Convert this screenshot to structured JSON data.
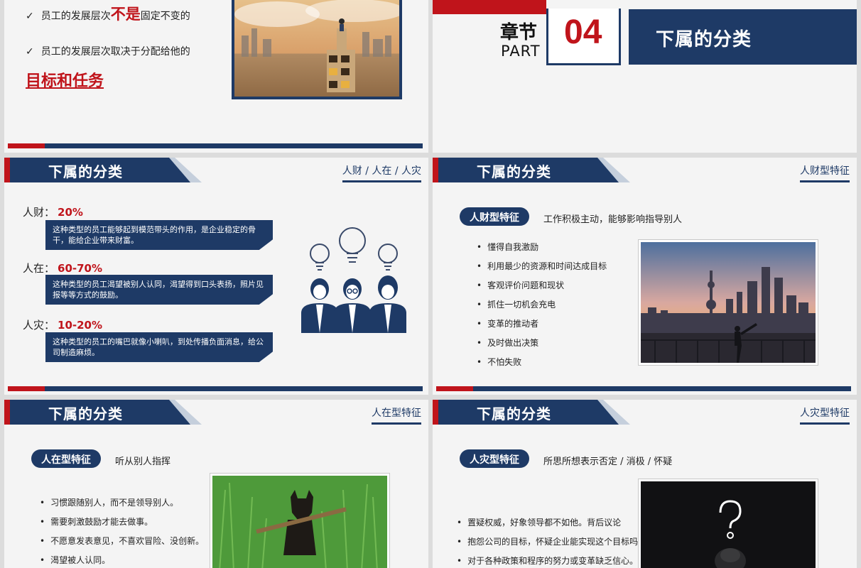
{
  "slide1": {
    "bullets": [
      {
        "mark": "✓",
        "before": "员工的发展层次",
        "highlight": "不是",
        "after": "固定不变的"
      },
      {
        "mark": "✓",
        "before": "员工的发展层次取决于分配给他的",
        "highlight": "",
        "after": ""
      }
    ],
    "emphasis": "目标和任务"
  },
  "slide2": {
    "chapter": "章节",
    "part": "PART",
    "number": "04",
    "title": "下属的分类"
  },
  "slide3": {
    "header": "下属的分类",
    "tag": "人财 / 人在 / 人灾",
    "items": [
      {
        "label": "人财：",
        "pct": "20%",
        "desc": "这种类型的员工能够起到模范带头的作用，是企业稳定的骨干，能给企业带来财富。"
      },
      {
        "label": "人在：",
        "pct": "60-70%",
        "desc": "这种类型的员工渴望被别人认同，渴望得到口头表扬，照片见报等等方式的鼓励。"
      },
      {
        "label": "人灾：",
        "pct": "10-20%",
        "desc": "这种类型的员工的嘴巴就像小喇叭，到处传播负面消息，给公司制造麻烦。"
      }
    ]
  },
  "slide4": {
    "header": "下属的分类",
    "tag": "人财型特征",
    "pill": "人财型特征",
    "pill_text": "工作积极主动，能够影响指导别人",
    "bullets": [
      "懂得自我激励",
      "利用最少的资源和时间达成目标",
      "客观评价问题和现状",
      "抓住一切机会充电",
      "变革的推动者",
      "及时做出决策",
      "不怕失败"
    ]
  },
  "slide5": {
    "header": "下属的分类",
    "tag": "人在型特征",
    "pill": "人在型特征",
    "pill_text": "听从别人指挥",
    "bullets": [
      "习惯跟随别人，而不是领导别人。",
      "需要刺激鼓励才能去做事。",
      "不愿意发表意见，不喜欢冒险、没创新。",
      "渴望被人认同。"
    ]
  },
  "slide6": {
    "header": "下属的分类",
    "tag": "人灾型特征",
    "pill": "人灾型特征",
    "pill_text": "所思所想表示否定 / 消极 / 怀疑",
    "bullets": [
      "置疑权威，好象领导都不如他。背后议论",
      "抱怨公司的目标，怀疑企业能实现这个目标吗?",
      "对于各种政策和程序的努力或变革缺乏信心。"
    ]
  },
  "colors": {
    "navy": "#1e3a66",
    "red": "#c0141b"
  }
}
